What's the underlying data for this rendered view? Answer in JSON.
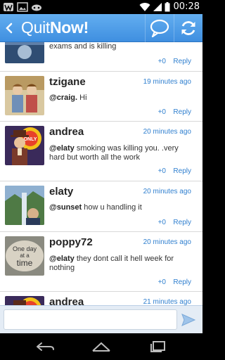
{
  "status_bar": {
    "time": "00:28"
  },
  "app": {
    "title_light": "Quit",
    "title_bold": "Now!"
  },
  "posts": [
    {
      "username": "",
      "time": "",
      "message": "exams and is killing",
      "mention": "",
      "votes": "+0",
      "reply": "Reply"
    },
    {
      "username": "tzigane",
      "time": "19 minutes ago",
      "mention": "@craig.",
      "message": " Hi",
      "votes": "+0",
      "reply": "Reply"
    },
    {
      "username": "andrea",
      "time": "20 minutes ago",
      "mention": "@elaty",
      "message": " smoking was killing you. .very hard but worth all the work",
      "votes": "+0",
      "reply": "Reply"
    },
    {
      "username": "elaty",
      "time": "20 minutes ago",
      "mention": "@sunset",
      "message": " how u handling it",
      "votes": "+0",
      "reply": "Reply"
    },
    {
      "username": "poppy72",
      "time": "20 minutes ago",
      "mention": "@elaty",
      "message": " they dont call it hell week for nothing",
      "votes": "+0",
      "reply": "Reply"
    },
    {
      "username": "andrea",
      "time": "21 minutes ago",
      "mention": "",
      "message": "",
      "votes": "",
      "reply": ""
    }
  ],
  "avatar_texts": {
    "candy": "ONLY",
    "stone_line1": "One day",
    "stone_line2": "at a",
    "stone_line3": "time"
  },
  "composer": {
    "value": "",
    "placeholder": ""
  },
  "colors": {
    "action_bar": "#4a9be8",
    "link": "#2f7fcf",
    "feed_bg": "#f4f4f4"
  }
}
